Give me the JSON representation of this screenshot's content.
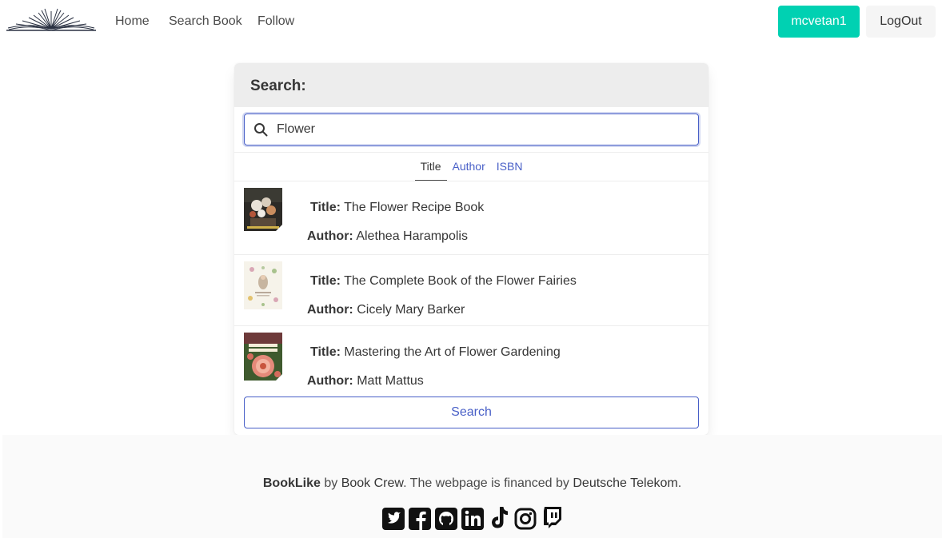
{
  "nav": {
    "links": [
      "Home",
      "Search Book",
      "Follow"
    ],
    "user_button": "mcvetan1",
    "logout_button": "LogOut"
  },
  "search": {
    "heading": "Search:",
    "query": "Flower",
    "tabs": [
      "Title",
      "Author",
      "ISBN"
    ],
    "active_tab": "Title",
    "button_label": "Search",
    "title_label": "Title:",
    "author_label": "Author:",
    "results": [
      {
        "title": "The Flower Recipe Book",
        "author": "Alethea Harampolis"
      },
      {
        "title": "The Complete Book of the Flower Fairies",
        "author": "Cicely Mary Barker"
      },
      {
        "title": "Mastering the Art of Flower Gardening",
        "author": "Matt Mattus"
      }
    ]
  },
  "footer": {
    "brand": "BookLike",
    "by": "by",
    "crew": "Book Crew",
    "financed": ". The webpage is financed by",
    "sponsor": "Deutsche Telekom",
    "end": ".",
    "socials": [
      "twitter-icon",
      "facebook-icon",
      "github-icon",
      "linkedin-icon",
      "tiktok-icon",
      "instagram-icon",
      "twitch-icon"
    ]
  },
  "colors": {
    "primary": "#00d1b2",
    "link": "#485fc7",
    "text": "#363636"
  }
}
